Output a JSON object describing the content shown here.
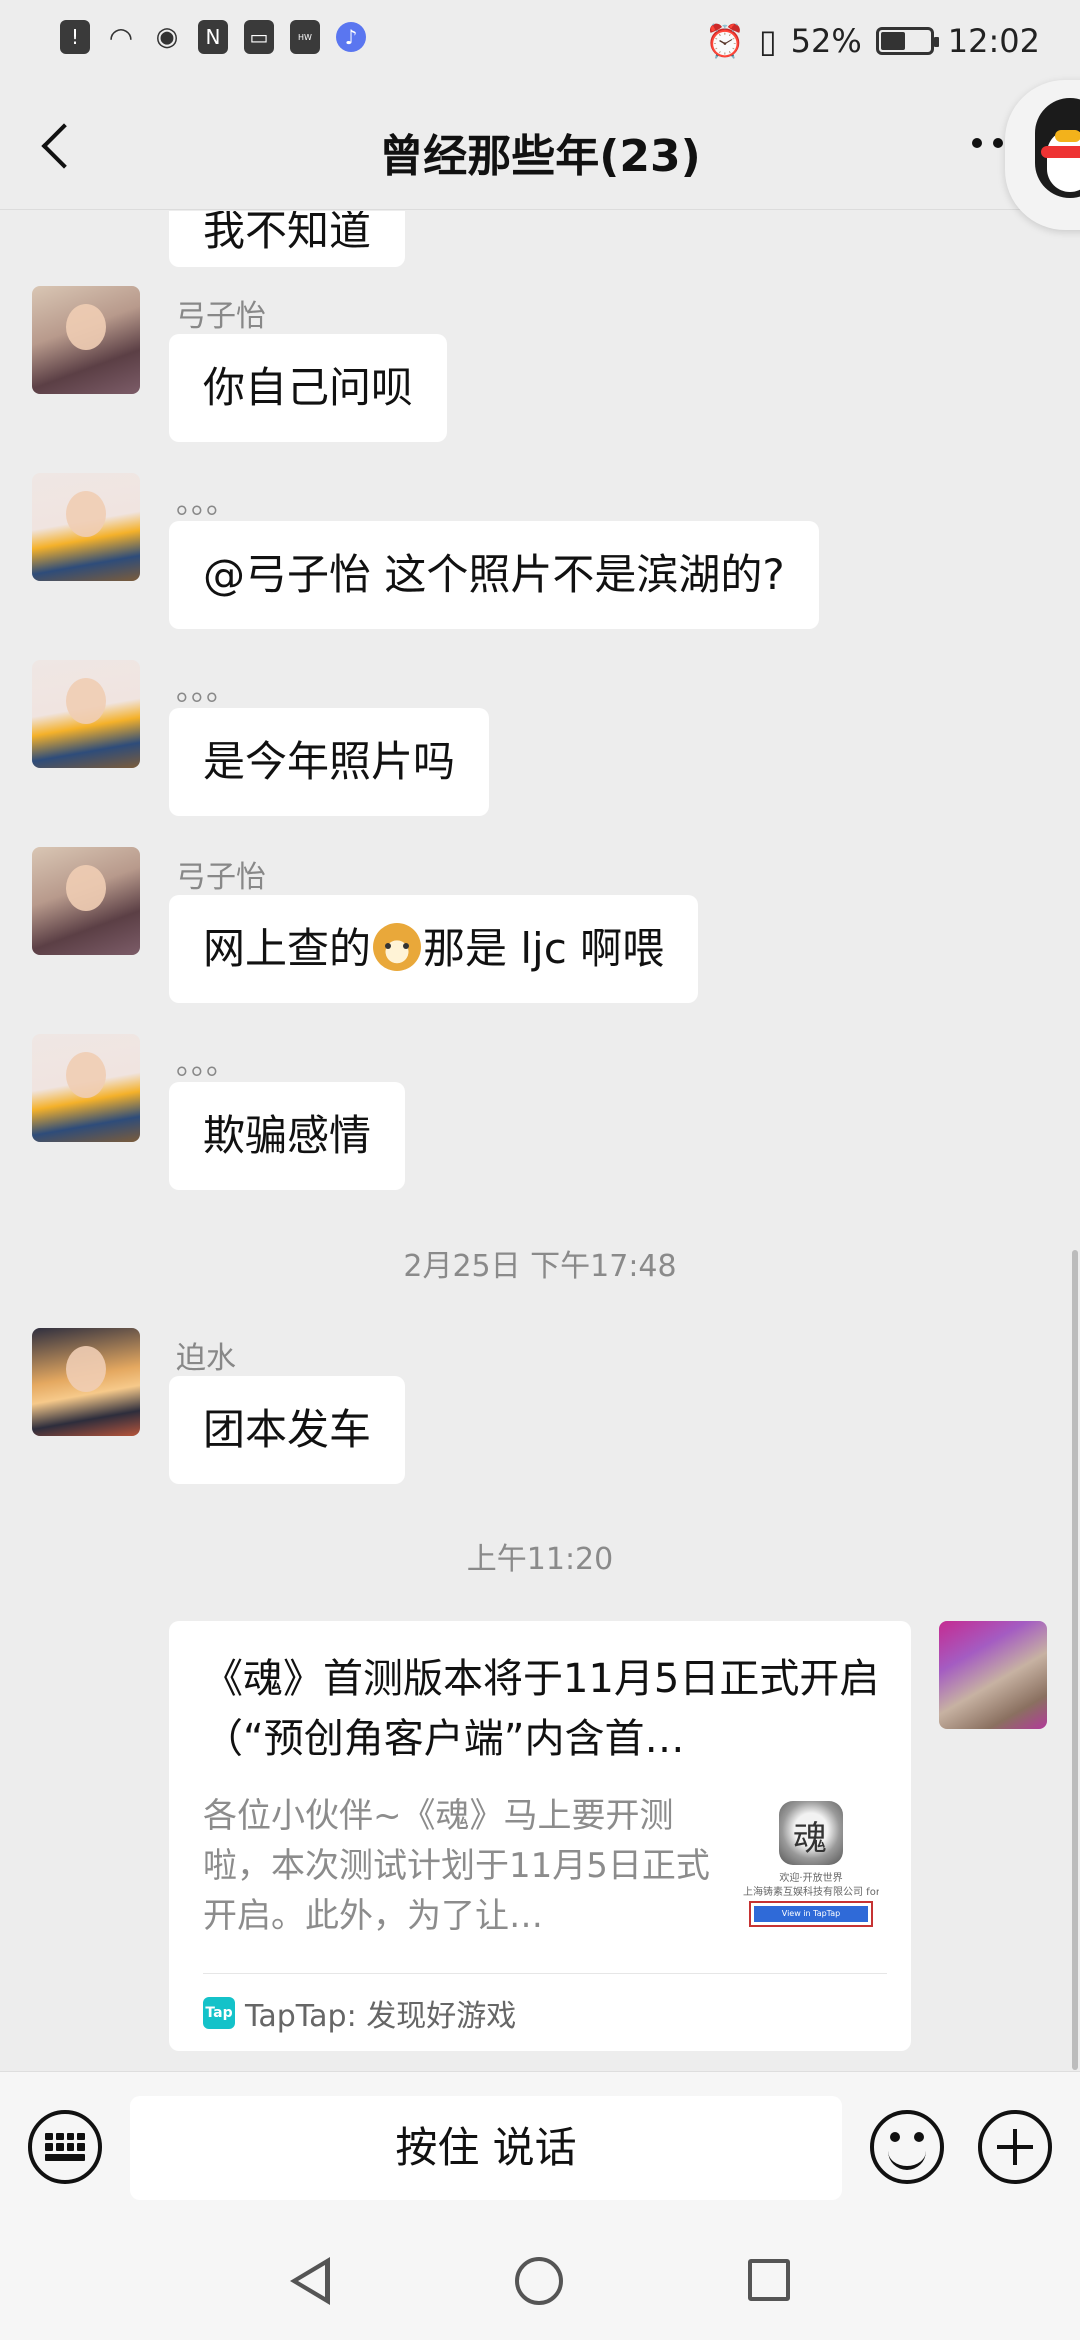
{
  "status_bar": {
    "battery_text": "52%",
    "battery_level": 0.52,
    "time": "12:02",
    "left_icons": [
      "notification-icon",
      "wifi-icon",
      "eye-icon",
      "nfc-icon",
      "tv-icon",
      "huawei-icon",
      "music-icon"
    ]
  },
  "header": {
    "title": "曾经那些年(23)"
  },
  "chat": {
    "partial_top_text": "我不知道",
    "messages": [
      {
        "sender": "弓子怡",
        "text": "你自己问呗",
        "avatar": "anime-girl"
      },
      {
        "sender": "。。。",
        "text": "@弓子怡  这个照片不是滨湖的?",
        "avatar": "boy-yellow-jacket"
      },
      {
        "sender": "。。。",
        "text": "是今年照片吗",
        "avatar": "boy-yellow-jacket"
      },
      {
        "sender": "弓子怡",
        "text_before": "网上查的",
        "emoji": "doge-emoji",
        "text_after": "那是 ljc 啊喂",
        "avatar": "anime-girl"
      },
      {
        "sender": "。。。",
        "text": "欺骗感情",
        "avatar": "boy-yellow-jacket"
      },
      {
        "sender": "迫水",
        "text": "团本发车",
        "avatar": "masked-anime"
      }
    ],
    "timestamps": [
      "2月25日 下午17:48",
      "上午11:20"
    ],
    "share_card": {
      "title": "《魂》首测版本将于11月5日正式开启（“预创角客户端”内含首…",
      "description": "各位小伙伴~《魂》马上要开测啦，本次测试计划于11月5日正式开启。此外，为了让…",
      "thumb_line1": "欢迎·开放世界",
      "thumb_line2": "上海铸素互娱科技有限公司 for iOS",
      "thumb_button": "View in TapTap",
      "source": "TapTap: 发现好游戏",
      "source_icon": "Tap"
    }
  },
  "input_bar": {
    "hold_to_talk": "按住 说话"
  }
}
